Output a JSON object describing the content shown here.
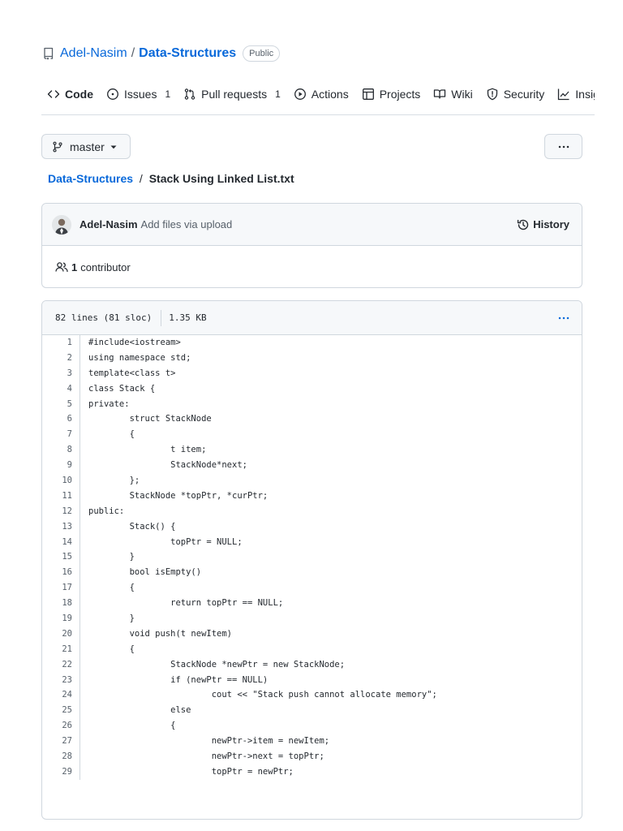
{
  "repo": {
    "owner": "Adel-Nasim",
    "separator": "/",
    "name": "Data-Structures",
    "visibility": "Public"
  },
  "nav": {
    "items": [
      {
        "label": "Code",
        "icon": "code-icon",
        "active": true
      },
      {
        "label": "Issues",
        "icon": "issue-icon",
        "count": "1"
      },
      {
        "label": "Pull requests",
        "icon": "pull-request-icon",
        "count": "1"
      },
      {
        "label": "Actions",
        "icon": "play-icon"
      },
      {
        "label": "Projects",
        "icon": "table-icon"
      },
      {
        "label": "Wiki",
        "icon": "book-icon"
      },
      {
        "label": "Security",
        "icon": "shield-icon"
      },
      {
        "label": "Insights",
        "icon": "graph-icon"
      }
    ]
  },
  "branch": {
    "label": "master",
    "icon": "git-branch-icon"
  },
  "more_icon": "kebab-horizontal-icon",
  "breadcrumb": {
    "repo": "Data-Structures",
    "separator": "/",
    "file": "Stack Using Linked List.txt"
  },
  "commit": {
    "author": "Adel-Nasim",
    "message": "Add files via upload",
    "history_label": "History",
    "avatar_icon": "user-avatar"
  },
  "contributors": {
    "count": "1",
    "label": "contributor",
    "icon": "people-icon"
  },
  "file": {
    "lines_info": "82 lines (81 sloc)",
    "size": "1.35 KB"
  },
  "code": {
    "lines": [
      "#include<iostream>",
      "using namespace std;",
      "template<class t>",
      "class Stack {",
      "private:",
      "\tstruct StackNode",
      "\t{",
      "\t\tt item;",
      "\t\tStackNode*next;",
      "\t};",
      "\tStackNode *topPtr, *curPtr;",
      "public:",
      "\tStack() {",
      "\t\ttopPtr = NULL;",
      "\t}",
      "\tbool isEmpty()",
      "\t{",
      "\t\treturn topPtr == NULL;",
      "\t}",
      "\tvoid push(t newItem)",
      "\t{",
      "\t\tStackNode *newPtr = new StackNode;",
      "\t\tif (newPtr == NULL)",
      "\t\t\tcout << \"Stack push cannot allocate memory\";",
      "\t\telse",
      "\t\t{",
      "\t\t\tnewPtr->item = newItem;",
      "\t\t\tnewPtr->next = topPtr;",
      "\t\t\ttopPtr = newPtr;"
    ]
  },
  "colors": {
    "link": "#0969da",
    "text": "#24292f",
    "muted": "#57606a",
    "border": "#d0d7de",
    "subtle_bg": "#f6f8fa"
  }
}
